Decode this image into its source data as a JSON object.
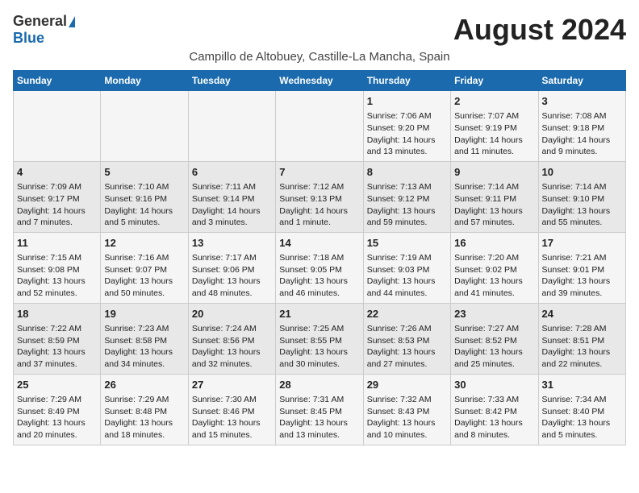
{
  "logo": {
    "general": "General",
    "blue": "Blue"
  },
  "title": "August 2024",
  "subtitle": "Campillo de Altobuey, Castille-La Mancha, Spain",
  "days_of_week": [
    "Sunday",
    "Monday",
    "Tuesday",
    "Wednesday",
    "Thursday",
    "Friday",
    "Saturday"
  ],
  "weeks": [
    [
      {
        "day": "",
        "content": ""
      },
      {
        "day": "",
        "content": ""
      },
      {
        "day": "",
        "content": ""
      },
      {
        "day": "",
        "content": ""
      },
      {
        "day": "1",
        "content": "Sunrise: 7:06 AM\nSunset: 9:20 PM\nDaylight: 14 hours\nand 13 minutes."
      },
      {
        "day": "2",
        "content": "Sunrise: 7:07 AM\nSunset: 9:19 PM\nDaylight: 14 hours\nand 11 minutes."
      },
      {
        "day": "3",
        "content": "Sunrise: 7:08 AM\nSunset: 9:18 PM\nDaylight: 14 hours\nand 9 minutes."
      }
    ],
    [
      {
        "day": "4",
        "content": "Sunrise: 7:09 AM\nSunset: 9:17 PM\nDaylight: 14 hours\nand 7 minutes."
      },
      {
        "day": "5",
        "content": "Sunrise: 7:10 AM\nSunset: 9:16 PM\nDaylight: 14 hours\nand 5 minutes."
      },
      {
        "day": "6",
        "content": "Sunrise: 7:11 AM\nSunset: 9:14 PM\nDaylight: 14 hours\nand 3 minutes."
      },
      {
        "day": "7",
        "content": "Sunrise: 7:12 AM\nSunset: 9:13 PM\nDaylight: 14 hours\nand 1 minute."
      },
      {
        "day": "8",
        "content": "Sunrise: 7:13 AM\nSunset: 9:12 PM\nDaylight: 13 hours\nand 59 minutes."
      },
      {
        "day": "9",
        "content": "Sunrise: 7:14 AM\nSunset: 9:11 PM\nDaylight: 13 hours\nand 57 minutes."
      },
      {
        "day": "10",
        "content": "Sunrise: 7:14 AM\nSunset: 9:10 PM\nDaylight: 13 hours\nand 55 minutes."
      }
    ],
    [
      {
        "day": "11",
        "content": "Sunrise: 7:15 AM\nSunset: 9:08 PM\nDaylight: 13 hours\nand 52 minutes."
      },
      {
        "day": "12",
        "content": "Sunrise: 7:16 AM\nSunset: 9:07 PM\nDaylight: 13 hours\nand 50 minutes."
      },
      {
        "day": "13",
        "content": "Sunrise: 7:17 AM\nSunset: 9:06 PM\nDaylight: 13 hours\nand 48 minutes."
      },
      {
        "day": "14",
        "content": "Sunrise: 7:18 AM\nSunset: 9:05 PM\nDaylight: 13 hours\nand 46 minutes."
      },
      {
        "day": "15",
        "content": "Sunrise: 7:19 AM\nSunset: 9:03 PM\nDaylight: 13 hours\nand 44 minutes."
      },
      {
        "day": "16",
        "content": "Sunrise: 7:20 AM\nSunset: 9:02 PM\nDaylight: 13 hours\nand 41 minutes."
      },
      {
        "day": "17",
        "content": "Sunrise: 7:21 AM\nSunset: 9:01 PM\nDaylight: 13 hours\nand 39 minutes."
      }
    ],
    [
      {
        "day": "18",
        "content": "Sunrise: 7:22 AM\nSunset: 8:59 PM\nDaylight: 13 hours\nand 37 minutes."
      },
      {
        "day": "19",
        "content": "Sunrise: 7:23 AM\nSunset: 8:58 PM\nDaylight: 13 hours\nand 34 minutes."
      },
      {
        "day": "20",
        "content": "Sunrise: 7:24 AM\nSunset: 8:56 PM\nDaylight: 13 hours\nand 32 minutes."
      },
      {
        "day": "21",
        "content": "Sunrise: 7:25 AM\nSunset: 8:55 PM\nDaylight: 13 hours\nand 30 minutes."
      },
      {
        "day": "22",
        "content": "Sunrise: 7:26 AM\nSunset: 8:53 PM\nDaylight: 13 hours\nand 27 minutes."
      },
      {
        "day": "23",
        "content": "Sunrise: 7:27 AM\nSunset: 8:52 PM\nDaylight: 13 hours\nand 25 minutes."
      },
      {
        "day": "24",
        "content": "Sunrise: 7:28 AM\nSunset: 8:51 PM\nDaylight: 13 hours\nand 22 minutes."
      }
    ],
    [
      {
        "day": "25",
        "content": "Sunrise: 7:29 AM\nSunset: 8:49 PM\nDaylight: 13 hours\nand 20 minutes."
      },
      {
        "day": "26",
        "content": "Sunrise: 7:29 AM\nSunset: 8:48 PM\nDaylight: 13 hours\nand 18 minutes."
      },
      {
        "day": "27",
        "content": "Sunrise: 7:30 AM\nSunset: 8:46 PM\nDaylight: 13 hours\nand 15 minutes."
      },
      {
        "day": "28",
        "content": "Sunrise: 7:31 AM\nSunset: 8:45 PM\nDaylight: 13 hours\nand 13 minutes."
      },
      {
        "day": "29",
        "content": "Sunrise: 7:32 AM\nSunset: 8:43 PM\nDaylight: 13 hours\nand 10 minutes."
      },
      {
        "day": "30",
        "content": "Sunrise: 7:33 AM\nSunset: 8:42 PM\nDaylight: 13 hours\nand 8 minutes."
      },
      {
        "day": "31",
        "content": "Sunrise: 7:34 AM\nSunset: 8:40 PM\nDaylight: 13 hours\nand 5 minutes."
      }
    ]
  ]
}
